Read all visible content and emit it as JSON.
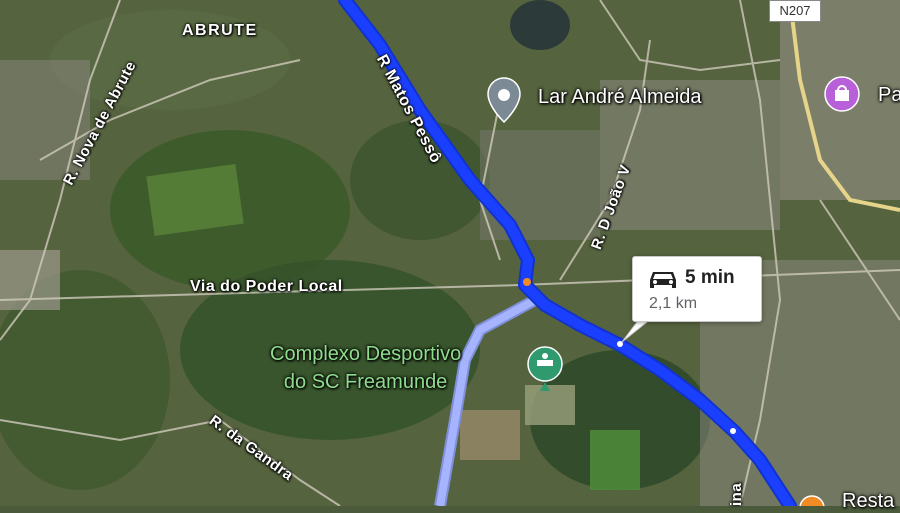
{
  "map": {
    "area_label": "ABRUTE",
    "streets": {
      "nova_de_abrute": "R. Nova de Abrute",
      "matos_pesso": "R Matos Pessô",
      "d_joao_v": "R. D João V",
      "via_poder_local": "Via do Poder Local",
      "da_gandra": "R. da Gandra",
      "partial_right": "ina"
    },
    "road_shield": "N207",
    "pois": {
      "lar_andre": "Lar André Almeida",
      "complexo_line1": "Complexo Desportivo",
      "complexo_line2": "do SC Freamunde",
      "partial_poi": "Pa",
      "partial_bottom": "Resta"
    },
    "route": {
      "duration": "5 min",
      "distance": "2,1 km",
      "color": "#1a3fff",
      "alt_color": "#a6b4ff"
    },
    "icons": [
      "car-icon",
      "place-marker-icon",
      "sports-complex-icon",
      "shopping-icon",
      "restaurant-icon"
    ]
  }
}
